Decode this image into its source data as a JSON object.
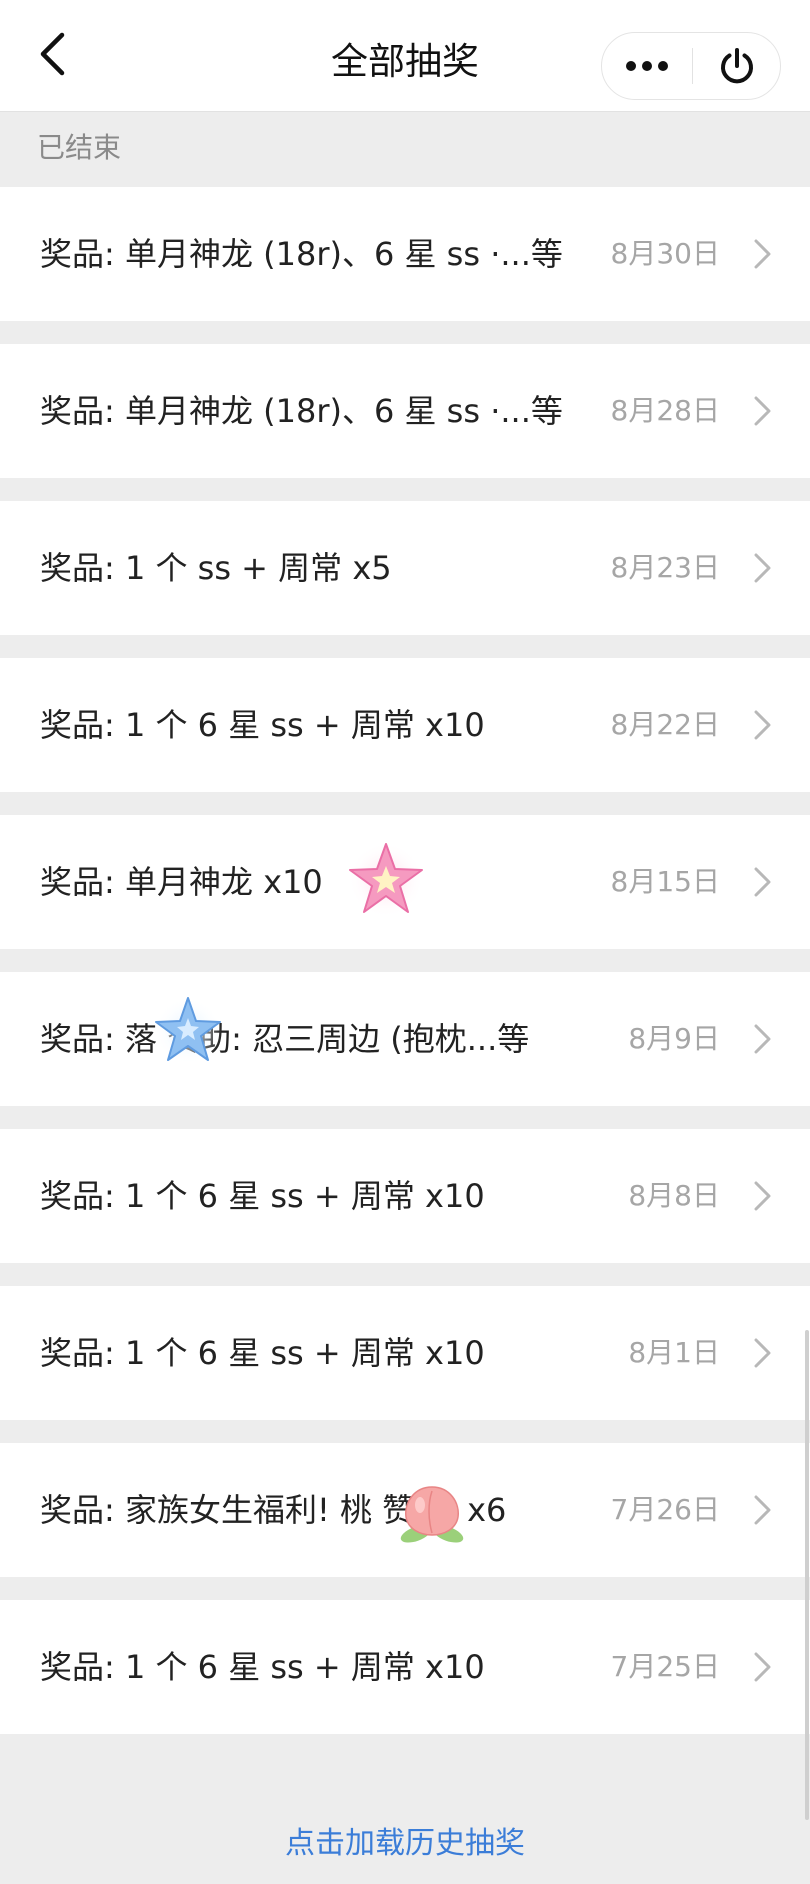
{
  "nav": {
    "title": "全部抽奖",
    "back_icon": "back-chevron-icon",
    "more_icon": "more-dots-icon",
    "close_icon": "power-icon"
  },
  "section": {
    "label": "已结束"
  },
  "rows": [
    {
      "title": "奖品: 单月神龙 (18r)、6 星 ss ·...等",
      "date": "8月30日"
    },
    {
      "title": "奖品: 单月神龙 (18r)、6 星 ss ·...等",
      "date": "8月28日"
    },
    {
      "title": "奖品: 1 个 ss + 周常  x5",
      "date": "8月23日"
    },
    {
      "title": "奖品: 1 个 6 星 ss + 周常  x10",
      "date": "8月22日"
    },
    {
      "title": "奖品: 单月神龙  x10",
      "date": "8月15日",
      "sticker": "pink-star-sticker"
    },
    {
      "title": "奖品: 落 赞助:  忍三周边 (抱枕...等",
      "date": "8月9日",
      "sticker": "blue-star-sticker"
    },
    {
      "title": "奖品: 1 个 6 星 ss + 周常  x10",
      "date": "8月8日"
    },
    {
      "title": "奖品: 1 个 6 星 ss + 周常  x10",
      "date": "8月1日"
    },
    {
      "title": "奖品: 家族女生福利!  桃  赞助:  x6",
      "date": "7月26日",
      "sticker": "peach-sticker"
    },
    {
      "title": "奖品: 1 个 6 星 ss + 周常  x10",
      "date": "7月25日"
    }
  ],
  "load_more": {
    "label": "点击加载历史抽奖"
  },
  "colors": {
    "link": "#3b7dd8",
    "date": "#a6a6a6",
    "background": "#ededed",
    "star_pink": "#f59ac0",
    "star_blue": "#8fc0f2",
    "peach": "#f6a7a6"
  }
}
